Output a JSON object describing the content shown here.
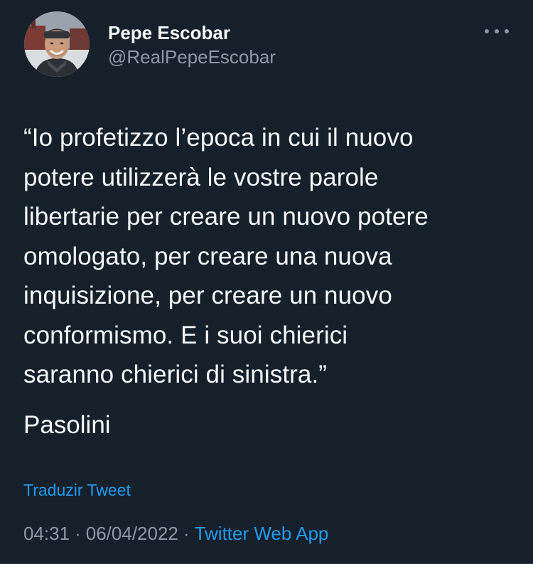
{
  "author": {
    "display_name": "Pepe Escobar",
    "handle": "@RealPepeEscobar"
  },
  "icons": {
    "more": "more-horizontal-icon",
    "avatar": "profile-photo"
  },
  "tweet": {
    "lines": [
      "“Io profetizzo l’epoca in cui il nuovo",
      "potere utilizzerà le vostre parole",
      "libertarie per creare un nuovo potere",
      "omologato, per creare una nuova",
      "inquisizione, per creare un nuovo",
      "conformismo. E i suoi chierici",
      "saranno chierici di sinistra.”"
    ],
    "attribution": "Pasolini",
    "translate_label": "Traduzir Tweet"
  },
  "meta": {
    "time": "04:31",
    "separator": "·",
    "date": "06/04/2022",
    "source": "Twitter Web App"
  },
  "colors": {
    "background": "#15202b",
    "primary_text": "#f7f9f9",
    "secondary_text": "#8b98a5",
    "accent": "#1d9bf0"
  }
}
